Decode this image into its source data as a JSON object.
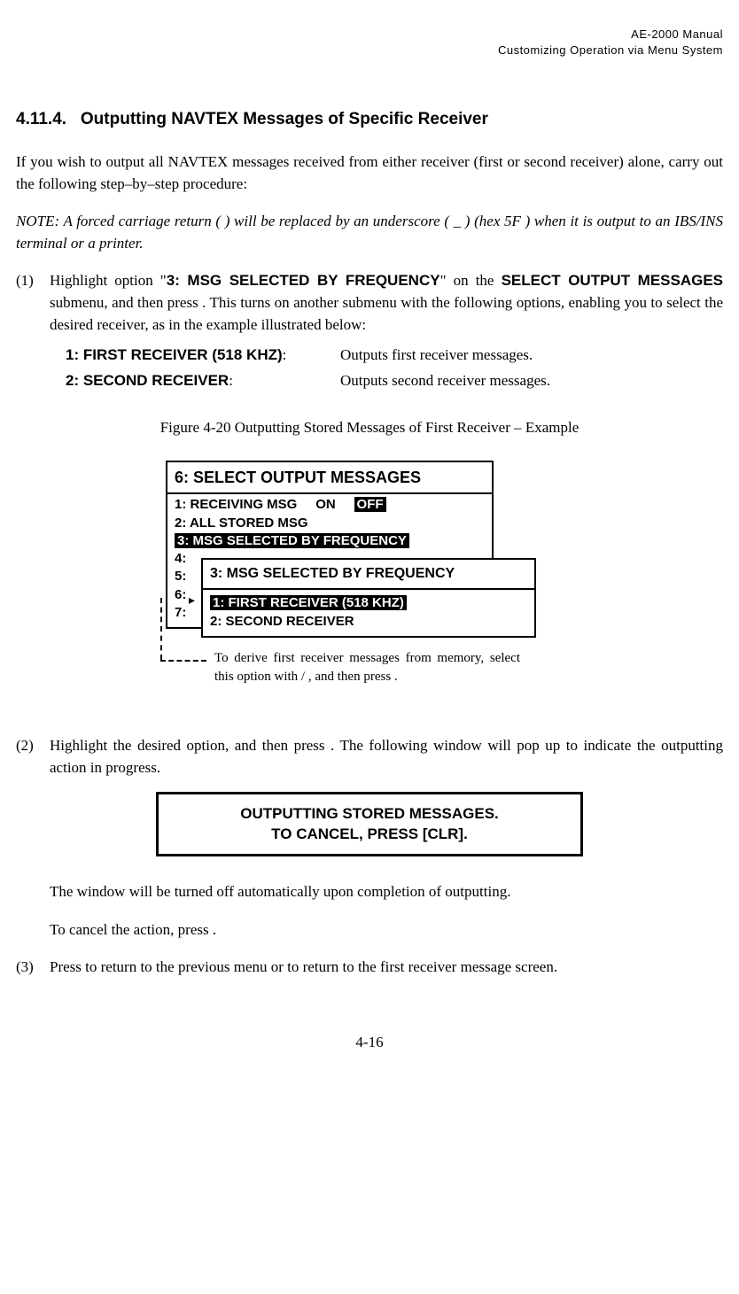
{
  "header": {
    "line1": "AE-2000 Manual",
    "line2": "Customizing Operation via Menu System"
  },
  "section": {
    "number": "4.11.4.",
    "title": "Outputting NAVTEX Messages of Specific Receiver"
  },
  "intro": "If you wish to output all NAVTEX messages received from either receiver (first or second receiver) alone, carry out the following step–by–step procedure:",
  "note": "NOTE: A forced carriage return ( ) will be replaced by an underscore ( _ ) (hex 5F ) when it is output to an IBS/INS terminal or a printer.",
  "step1": {
    "num": "(1)",
    "part1": "Highlight option \"",
    "opt": "3: MSG SELECTED BY FREQUENCY",
    "part2": "\" on the ",
    "opt2": "SELECT OUTPUT MESSAGES",
    "part3": " submenu, and then press ",
    "part4": " . This turns on another submenu with the following options, enabling you to select the desired receiver, as in the example illustrated below:"
  },
  "options": [
    {
      "label": "1: FIRST RECEIVER (518 KHZ)",
      "colon": ":",
      "desc": "Outputs first receiver messages."
    },
    {
      "label": "2: SECOND RECEIVER",
      "colon": ":",
      "desc": "Outputs second receiver messages."
    }
  ],
  "figure_caption": "Figure 4-20   Outputting Stored Messages of First Receiver – Example",
  "menu": {
    "main_title": "6: SELECT OUTPUT MESSAGES",
    "row1_label": "1: RECEIVING MSG",
    "row1_on": "ON",
    "row1_off": "OFF",
    "row2": "2: ALL STORED MSG",
    "row3": "3: MSG SELECTED BY FREQUENCY",
    "row4": "4:",
    "row5": "5:",
    "row6": "6:",
    "row7": "7:",
    "sub_title": "3: MSG SELECTED BY FREQUENCY",
    "sub_row1": "1: FIRST RECEIVER (518 KHZ)",
    "sub_row2": "2: SECOND RECEIVER"
  },
  "diagram_note": "To derive first receiver messages from memory, select this option with  /  , and then press  .",
  "step2": {
    "num": "(2)",
    "part1": "Highlight the desired option, and then press ",
    "part2": " . The following window will pop up to indicate the outputting action in progress."
  },
  "popup": {
    "line1": "OUTPUTTING STORED MESSAGES.",
    "line2": "TO CANCEL, PRESS [CLR]."
  },
  "after_popup1": "The window will be turned off automatically upon completion of outputting.",
  "after_popup2": "To cancel the action, press  .",
  "step3": {
    "num": "(3)",
    "text": "Press   to return to the previous menu or   to return to the first receiver message screen."
  },
  "footer": "4-16"
}
